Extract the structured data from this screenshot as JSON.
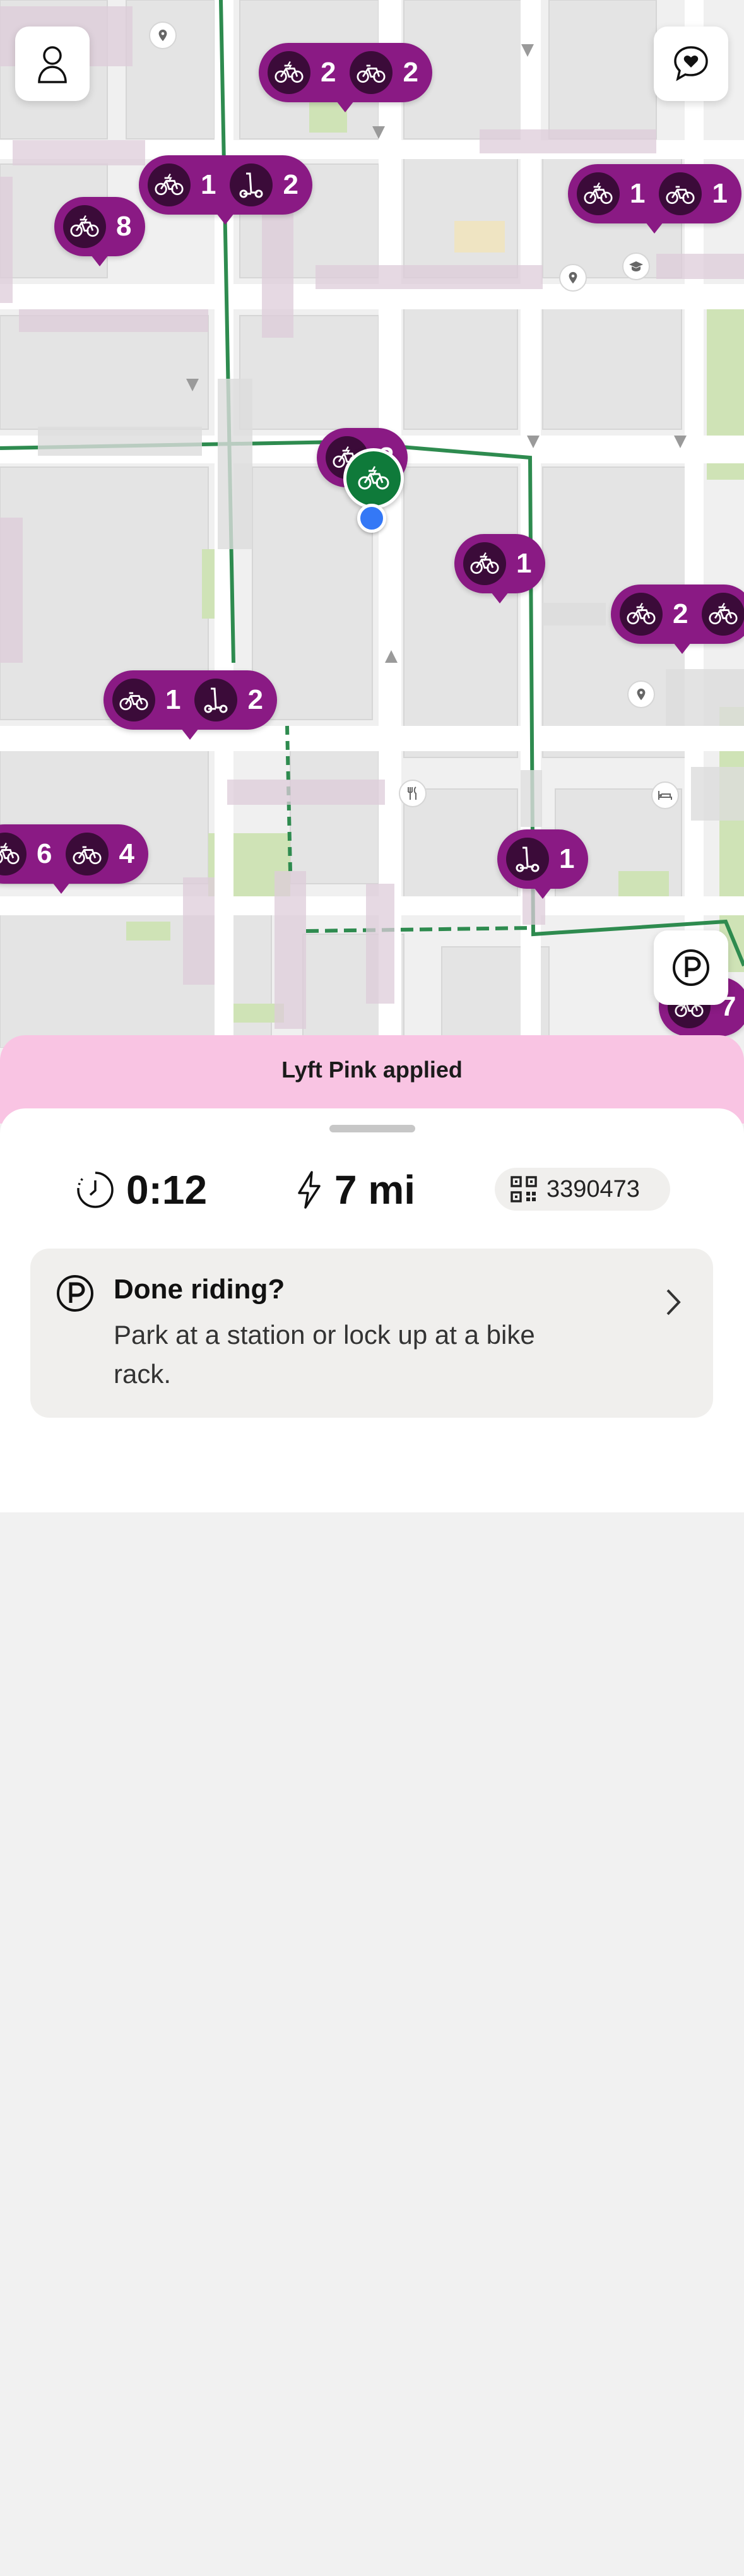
{
  "map": {
    "markers": [
      {
        "name": "marker-a",
        "groups": [
          {
            "icon": "ebike-icon",
            "count": "2"
          },
          {
            "icon": "bike-icon",
            "count": "2"
          }
        ]
      },
      {
        "name": "marker-b",
        "groups": [
          {
            "icon": "ebike-icon",
            "count": "1"
          },
          {
            "icon": "scooter-icon",
            "count": "2"
          }
        ]
      },
      {
        "name": "marker-c",
        "groups": [
          {
            "icon": "ebike-icon",
            "count": "8"
          }
        ]
      },
      {
        "name": "marker-d",
        "groups": [
          {
            "icon": "ebike-icon",
            "count": "1"
          },
          {
            "icon": "bike-icon",
            "count": "1"
          }
        ]
      },
      {
        "name": "marker-e",
        "groups": [
          {
            "icon": "ebike-icon",
            "count": "1"
          }
        ]
      },
      {
        "name": "marker-f",
        "groups": [
          {
            "icon": "ebike-icon",
            "count": "2"
          },
          {
            "icon": "ebike-icon",
            "count": ""
          }
        ]
      },
      {
        "name": "marker-g",
        "groups": [
          {
            "icon": "bike-icon",
            "count": "1"
          },
          {
            "icon": "scooter-icon",
            "count": "2"
          }
        ]
      },
      {
        "name": "marker-h",
        "groups": [
          {
            "icon": "ebike-icon",
            "count": "6"
          },
          {
            "icon": "bike-icon",
            "count": "4"
          }
        ]
      },
      {
        "name": "marker-i",
        "groups": [
          {
            "icon": "scooter-icon",
            "count": "1"
          }
        ]
      },
      {
        "name": "marker-j",
        "groups": [
          {
            "icon": "bike-icon",
            "count": "7"
          }
        ]
      },
      {
        "name": "marker-k",
        "groups": [
          {
            "icon": "ebike-icon",
            "count": "2"
          }
        ]
      }
    ],
    "buttons": {
      "profile_icon": "person-icon",
      "chat_icon": "chat-heart-icon",
      "parking_icon": "parking-icon"
    },
    "colors": {
      "marker": "#8a1a84",
      "marker_icon_bg": "#3b0b39",
      "active_bike": "#0f7a3a",
      "bike_lane": "#2e8b4f",
      "location_dot": "#3478f6"
    }
  },
  "banner": {
    "text": "Lyft Pink applied"
  },
  "ride": {
    "time": "0:12",
    "range": "7 mi",
    "bike_id": "3390473"
  },
  "done_card": {
    "title": "Done riding?",
    "subtitle": "Park at a station or lock up at a bike rack."
  }
}
